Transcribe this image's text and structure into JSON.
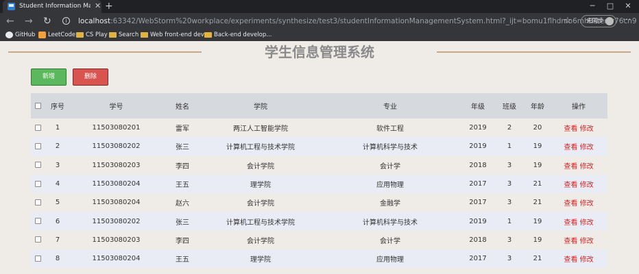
{
  "browser": {
    "tab_title": "Student Information Manageme",
    "url_host": "localhost",
    "url_rest": ":63342/WebStorm%20workplace/experiments/synthesize/test3/studentInformationManagementSystem.html?_ijt=bomu1flhdmo6mh3sterkr76cn9",
    "profile_label": "未同步",
    "bookmarks": [
      {
        "label": "GitHub",
        "icon": "github-icon"
      },
      {
        "label": "LeetCode",
        "icon": "leetcode-icon"
      },
      {
        "label": "CS Play",
        "icon": "folder-icon"
      },
      {
        "label": "Search",
        "icon": "folder-icon"
      },
      {
        "label": "Web front-end dev...",
        "icon": "folder-icon"
      },
      {
        "label": "Back-end develop...",
        "icon": "folder-icon"
      }
    ]
  },
  "page": {
    "title": "学生信息管理系统",
    "add_label": "新增",
    "delete_label": "删除"
  },
  "table": {
    "headers": [
      "序号",
      "学号",
      "姓名",
      "学院",
      "专业",
      "年级",
      "班级",
      "年龄",
      "操作"
    ],
    "view_label": "查看",
    "edit_label": "修改",
    "rows": [
      {
        "no": "1",
        "id": "11503080201",
        "name": "雷军",
        "college": "两江人工智能学院",
        "major": "软件工程",
        "grade": "2019",
        "class": "2",
        "age": "20"
      },
      {
        "no": "2",
        "id": "11503080202",
        "name": "张三",
        "college": "计算机工程与技术学院",
        "major": "计算机科学与技术",
        "grade": "2019",
        "class": "1",
        "age": "19"
      },
      {
        "no": "3",
        "id": "11503080203",
        "name": "李四",
        "college": "会计学院",
        "major": "会计学",
        "grade": "2018",
        "class": "3",
        "age": "19"
      },
      {
        "no": "4",
        "id": "11503080204",
        "name": "王五",
        "college": "理学院",
        "major": "应用物理",
        "grade": "2017",
        "class": "3",
        "age": "21"
      },
      {
        "no": "5",
        "id": "11503080204",
        "name": "赵六",
        "college": "会计学院",
        "major": "金融学",
        "grade": "2017",
        "class": "3",
        "age": "21"
      },
      {
        "no": "6",
        "id": "11503080202",
        "name": "张三",
        "college": "计算机工程与技术学院",
        "major": "计算机科学与技术",
        "grade": "2019",
        "class": "1",
        "age": "19"
      },
      {
        "no": "7",
        "id": "11503080203",
        "name": "李四",
        "college": "会计学院",
        "major": "会计学",
        "grade": "2018",
        "class": "3",
        "age": "19"
      },
      {
        "no": "8",
        "id": "11503080204",
        "name": "王五",
        "college": "理学院",
        "major": "应用物理",
        "grade": "2017",
        "class": "3",
        "age": "21"
      },
      {
        "no": "",
        "id": "",
        "name": "",
        "college": "",
        "major": "",
        "grade": "",
        "class": "",
        "age": ""
      }
    ]
  },
  "colors": {
    "add_button": "#5cb85c",
    "delete_button": "#d9534f",
    "action_link": "#e21d1d",
    "header_bg": "#d6d9dd",
    "row_alt_bg": "#e9ecf4",
    "title_line": "#c9a98a"
  }
}
